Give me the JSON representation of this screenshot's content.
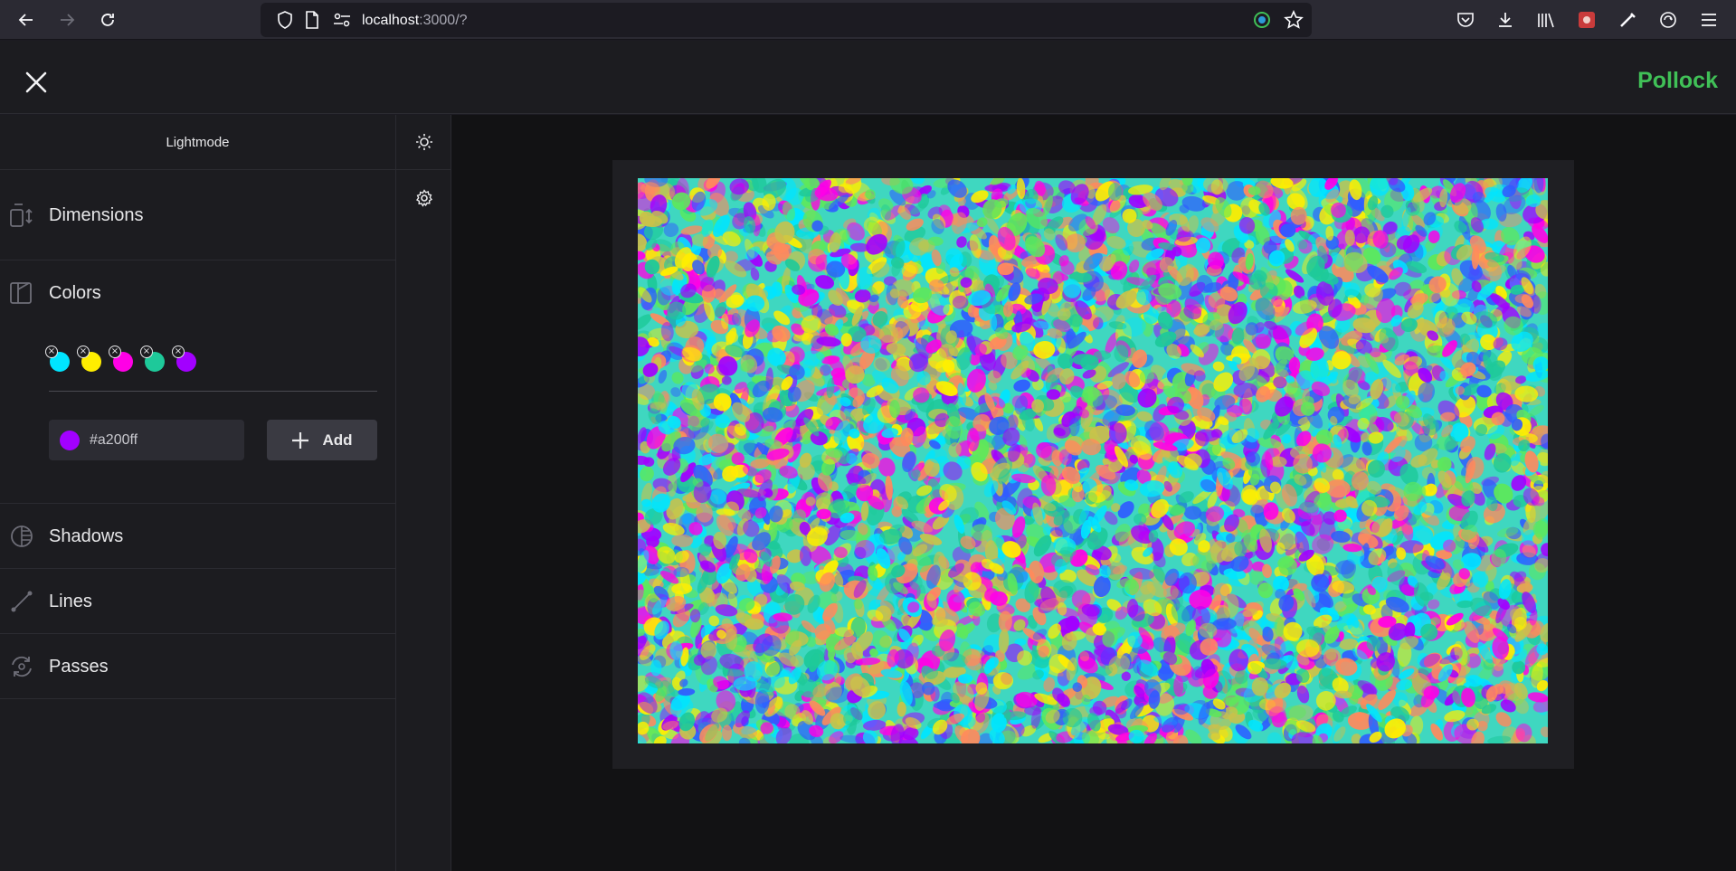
{
  "browser": {
    "url_host": "localhost",
    "url_rest": ":3000/?",
    "icons": [
      "back-icon",
      "forward-icon",
      "reload-icon",
      "shield-icon",
      "page-icon",
      "site-permissions-icon",
      "extension-icon",
      "bookmark-star-icon",
      "pocket-icon",
      "download-icon",
      "library-icon",
      "extension-icon",
      "extension-icon",
      "sync-icon",
      "menu-icon"
    ]
  },
  "header": {
    "brand": "Pollock",
    "brand_color": "#40c057"
  },
  "sidebar": {
    "mode_label": "Lightmode",
    "sections": {
      "dimensions": "Dimensions",
      "colors": "Colors",
      "shadows": "Shadows",
      "lines": "Lines",
      "passes": "Passes"
    },
    "colors": {
      "swatches": [
        "#00e5ff",
        "#ffee00",
        "#ff00e6",
        "#1ec99a",
        "#a200ff"
      ],
      "input_value": "#a200ff",
      "add_label": "Add"
    }
  }
}
